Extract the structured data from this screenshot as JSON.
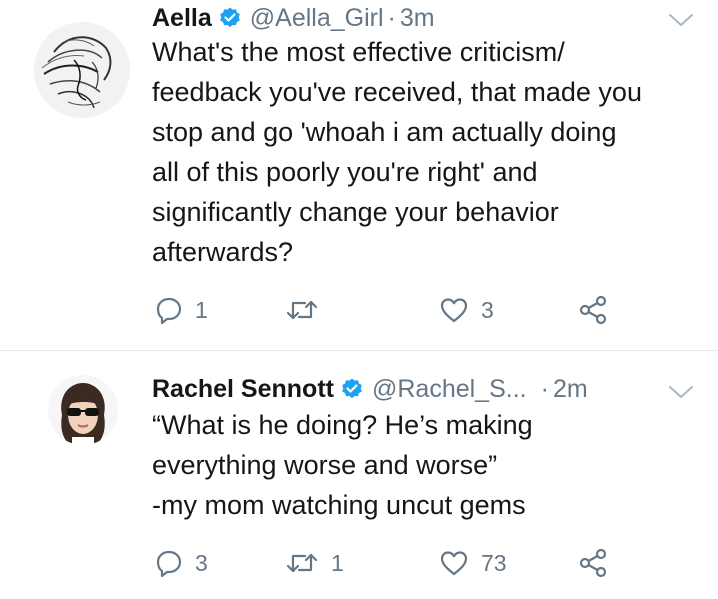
{
  "tweets": [
    {
      "author_name": "Aella",
      "verified": true,
      "handle": "@Aella_Girl",
      "separator": "·",
      "time": "3m",
      "text": "What's the most effective criticism/\nfeedback you've received, that made you\nstop and go 'whoah i am actually doing\nall of this poorly you're right' and\nsignificantly change your behavior\nafterwards?",
      "replies": "1",
      "retweets": "",
      "likes": "3"
    },
    {
      "author_name": "Rachel Sennott",
      "verified": true,
      "handle": "@Rachel_S...",
      "separator": "·",
      "time": "2m",
      "text": "“What is he doing? He’s making\neverything worse and worse”\n-my mom watching uncut gems",
      "replies": "3",
      "retweets": "1",
      "likes": "73"
    }
  ],
  "icons": {
    "reply": "reply-icon",
    "retweet": "retweet-icon",
    "like": "heart-icon",
    "share": "share-icon",
    "verified": "verified-badge-icon",
    "menu": "chevron-down-icon"
  },
  "colors": {
    "text": "#14171a",
    "secondary": "#657786",
    "verified": "#1da1f2",
    "divider": "#e1e8ed"
  }
}
